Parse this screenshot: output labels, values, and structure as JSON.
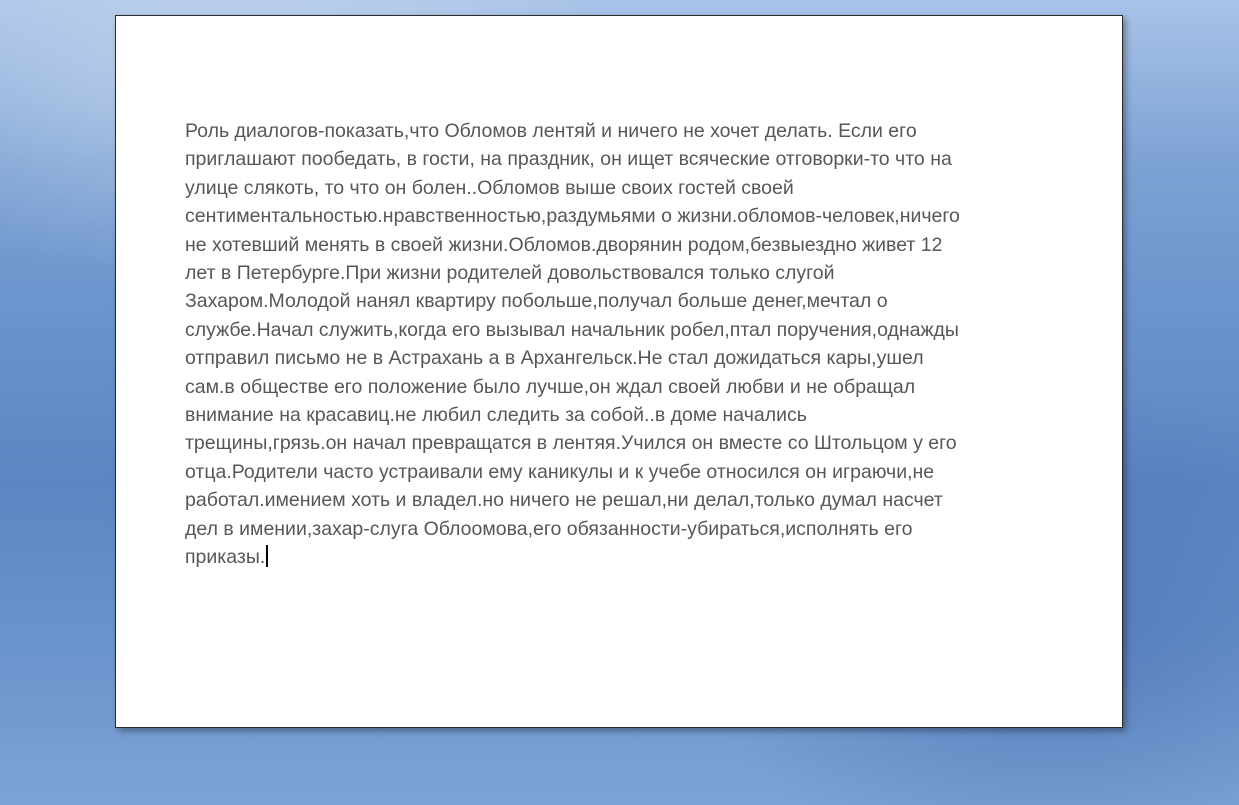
{
  "document": {
    "body_text": "Роль диалогов-показать,что Обломов лентяй и ничего не хочет делать. Если его\nприглашают пообедать, в гости, на праздник, он ищет всяческие отговорки-то что на\nулице слякоть, то что он болен..Обломов выше своих гостей своей\nсентиментальностью.нравственностью,раздумьями о жизни.обломов-человек,ничего\nне хотевший менять в своей жизни.Обломов.дворянин родом,безвыездно живет 12\nлет в  Петербурге.При жизни родителей довольствовался только слугой\nЗахаром.Молодой нанял квартиру побольше,получал больше денег,мечтал о\nслужбе.Начал служить,когда его вызывал начальник робел,птал поручения,однажды\nотправил письмо не в Астрахань а в Архангельск.Не стал дожидаться кары,ушел\nсам.в обществе его положение было лучше,он ждал своей любви и не обращал\nвнимание на красавиц.не любил следить за собой..в доме начались\nтрещины,грязь.он начал превращатся в лентяя.Учился он вместе со Штольцом у его\nотца.Родители часто устраивали ему каникулы и к учебе относился он играючи,не\nработал.имением хоть и владел.но ничего не решал,ни делал,только думал насчет\nдел в имении,захар-слуга Облоомова,его обязанности-убираться,исполнять его\nприказы."
  },
  "colors": {
    "text": "#575757",
    "page": "#ffffff",
    "background": "#6a93cc"
  }
}
